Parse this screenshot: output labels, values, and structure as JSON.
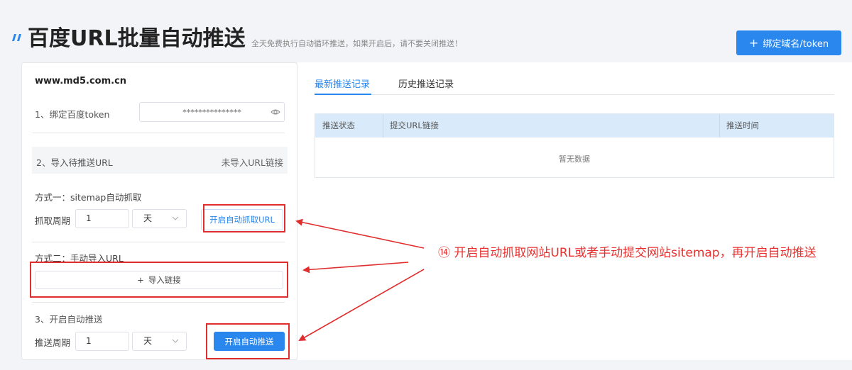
{
  "header": {
    "title": "百度URL批量自动推送",
    "subtitle": "全天免费执行自动循环推送，如果开启后，请不要关闭推送！",
    "bind_button_label": "绑定域名/token"
  },
  "left_panel": {
    "domain": "www.md5.com.cn",
    "step1": {
      "label": "1、绑定百度token",
      "token_value": "***************"
    },
    "step2": {
      "label": "2、导入待推送URL",
      "status": "未导入URL链接"
    },
    "method1": {
      "title": "方式一：sitemap自动抓取",
      "period_label": "抓取周期",
      "period_value": "1",
      "unit": "天",
      "button_label": "开启自动抓取URL"
    },
    "method2": {
      "title": "方式二：手动导入URL",
      "button_label": "导入链接"
    },
    "step3": {
      "label": "3、开启自动推送",
      "period_label": "推送周期",
      "period_value": "1",
      "unit": "天",
      "button_label": "开启自动推送"
    }
  },
  "right_panel": {
    "tabs": [
      {
        "label": "最新推送记录",
        "active": true
      },
      {
        "label": "历史推送记录",
        "active": false
      }
    ],
    "table": {
      "columns": [
        "推送状态",
        "提交URL链接",
        "推送时间"
      ],
      "empty_text": "暂无数据"
    }
  },
  "annotation": {
    "text": "⑭ 开启自动抓取网站URL或者手动提交网站sitemap，再开启自动推送"
  },
  "colors": {
    "primary": "#2a87ee",
    "annotation_red": "#e02d2d",
    "table_header": "#d9ebfb"
  }
}
